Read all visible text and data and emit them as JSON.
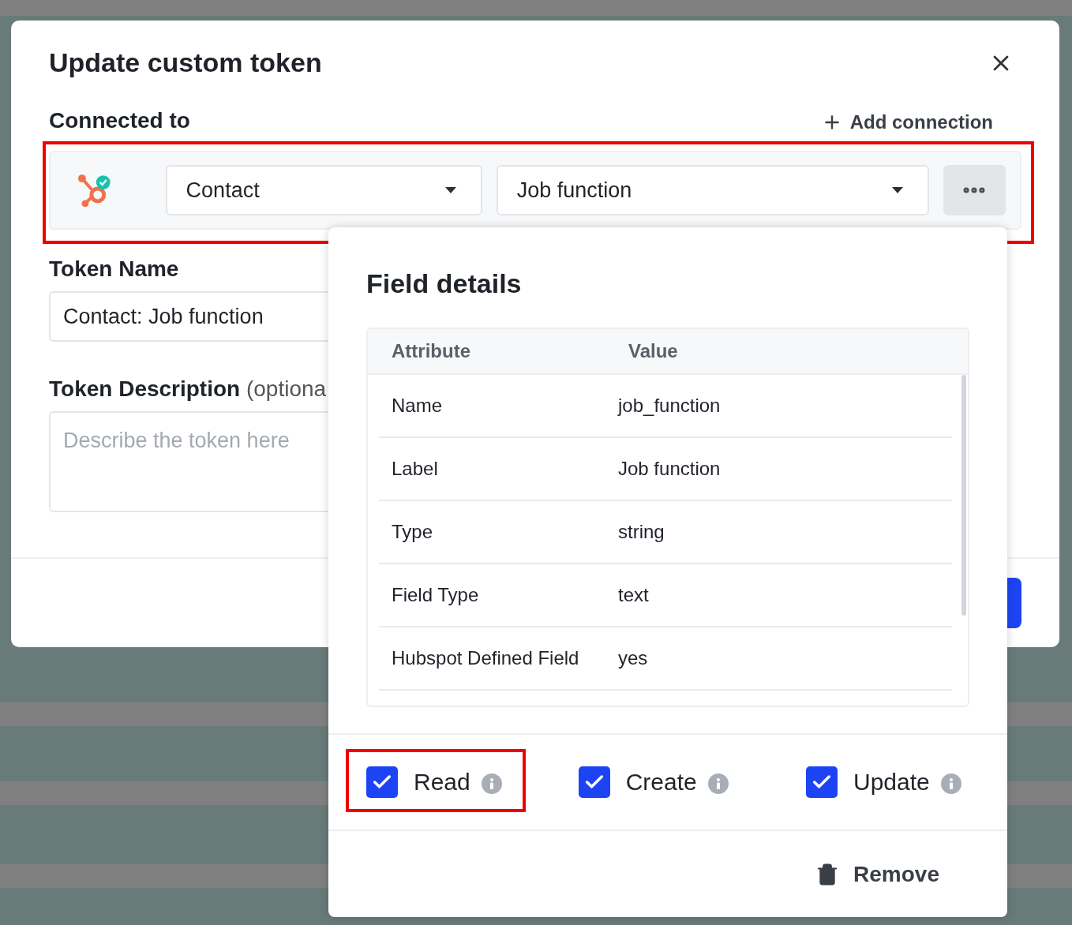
{
  "modal": {
    "title": "Update custom token",
    "connected_label": "Connected to",
    "add_connection": "Add connection",
    "connection": {
      "object_select": "Contact",
      "field_select": "Job function",
      "highlighted": true
    },
    "token_name": {
      "label": "Token Name",
      "value": "Contact: Job function"
    },
    "token_description": {
      "label": "Token Description",
      "optional": "(optiona",
      "placeholder": "Describe the token here"
    }
  },
  "field_details": {
    "title": "Field details",
    "columns": [
      "Attribute",
      "Value"
    ],
    "rows": [
      {
        "attribute": "Name",
        "value": "job_function"
      },
      {
        "attribute": "Label",
        "value": "Job function"
      },
      {
        "attribute": "Type",
        "value": "string"
      },
      {
        "attribute": "Field Type",
        "value": "text"
      },
      {
        "attribute": "Hubspot Defined Field",
        "value": "yes"
      }
    ],
    "permissions": [
      {
        "label": "Read",
        "checked": true,
        "highlighted": true
      },
      {
        "label": "Create",
        "checked": true,
        "highlighted": false
      },
      {
        "label": "Update",
        "checked": true,
        "highlighted": false
      }
    ],
    "remove": "Remove"
  }
}
